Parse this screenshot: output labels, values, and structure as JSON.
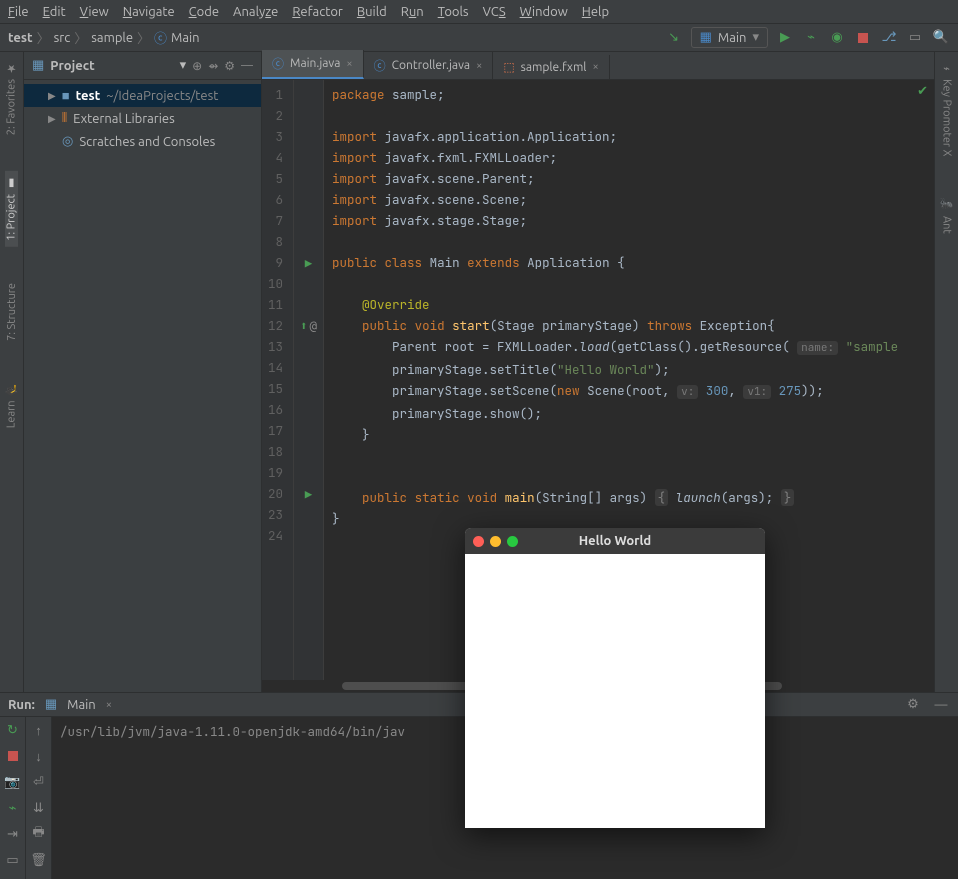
{
  "menubar": [
    "File",
    "Edit",
    "View",
    "Navigate",
    "Code",
    "Analyze",
    "Refactor",
    "Build",
    "Run",
    "Tools",
    "VCS",
    "Window",
    "Help"
  ],
  "breadcrumb": {
    "project": "test",
    "src": "src",
    "pkg": "sample",
    "file": "Main"
  },
  "runConfig": "Main",
  "leftGutter": {
    "favorites": "2: Favorites",
    "project": "1: Project",
    "structure": "7: Structure",
    "learn": "Learn"
  },
  "rightGutter": {
    "keypromoter": "Key Promoter X",
    "ant": "Ant"
  },
  "projectPanel": {
    "title": "Project",
    "root": {
      "name": "test",
      "path": "~/IdeaProjects/test"
    },
    "extlib": "External Libraries",
    "scratch": "Scratches and Consoles"
  },
  "tabs": [
    {
      "name": "Main.java",
      "active": true
    },
    {
      "name": "Controller.java",
      "active": false
    },
    {
      "name": "sample.fxml",
      "active": false
    }
  ],
  "lines": [
    "1",
    "2",
    "3",
    "4",
    "5",
    "6",
    "7",
    "8",
    "9",
    "10",
    "11",
    "12",
    "13",
    "14",
    "15",
    "16",
    "17",
    "18",
    "19",
    "20",
    "23",
    "24"
  ],
  "code": {
    "pkg": "package",
    "sample": "sample",
    "imp": "import",
    "l3": "javafx.application.Application",
    "l4": "javafx.fxml.FXMLLoader",
    "l5": "javafx.scene.Parent",
    "l6": "javafx.scene.Scene",
    "l7": "javafx.stage.Stage",
    "public": "public",
    "class": "class",
    "Main": "Main",
    "extends": "extends",
    "Application": "Application",
    "override": "@Override",
    "void": "void",
    "start": "start",
    "stageParam": "(Stage primaryStage)",
    "throws": "throws",
    "Exception": "Exception{",
    "l13a": "Parent root = FXMLLoader.",
    "load": "load",
    "l13b": "(getClass().getResource(",
    "hint1": "name:",
    "str1": "\"sample",
    "l14a": "primaryStage.setTitle(",
    "str2": "\"Hello World\"",
    "l14b": ");",
    "l15a": "primaryStage.setScene(",
    "new": "new",
    "l15b": " Scene(root,",
    "hint2": "v:",
    "num1": "300",
    "hint3": "v1:",
    "num2": "275",
    "l15c": "));",
    "l16": "primaryStage.show();",
    "static": "static",
    "main": "main",
    "mainArgs": "(String[] args)",
    "launch": "launch",
    "launchArgs": "(args)"
  },
  "runPanel": {
    "label": "Run:",
    "config": "Main",
    "console": "/usr/lib/jvm/java-1.11.0-openjdk-amd64/bin/jav"
  },
  "popup": {
    "title": "Hello World"
  }
}
